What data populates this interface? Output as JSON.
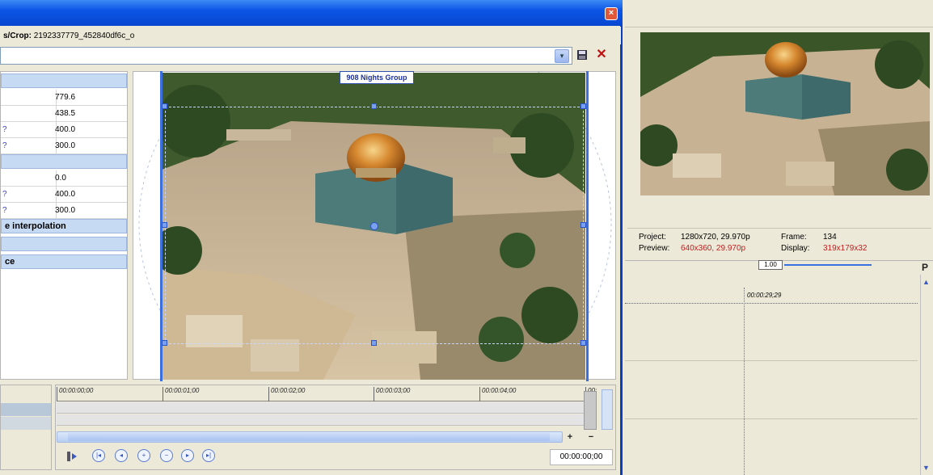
{
  "dialog": {
    "close_glyph": "×",
    "path_prefix": "s/Crop:",
    "path_value": " 2192337779_452840df6c_o"
  },
  "preset": {
    "value": "",
    "dropdown_glyph": "▾",
    "save_glyph": "🖫",
    "delete_glyph": "✕"
  },
  "properties": {
    "rows_a": [
      {
        "label": "",
        "value": "779.6"
      },
      {
        "label": "",
        "value": "438.5"
      },
      {
        "label": "?",
        "value": "400.0"
      },
      {
        "label": "?",
        "value": "300.0"
      }
    ],
    "rows_b": [
      {
        "label": "",
        "value": "0.0"
      },
      {
        "label": "?",
        "value": "400.0"
      },
      {
        "label": "?",
        "value": "300.0"
      }
    ],
    "section_interp": "e interpolation",
    "section_last": "ce"
  },
  "preview": {
    "overlay_label": "908 Nights Group"
  },
  "timeline": {
    "ticks": [
      "00:00:00;00",
      "00:00:01;00",
      "00:00:02;00",
      "00:00:03;00",
      "00:00:04;00",
      "00:"
    ],
    "timecode": "00:00:00;00",
    "zoom_plus": "+",
    "zoom_minus": "−",
    "controls": [
      "first-keyframe",
      "prev-keyframe",
      "add-keyframe",
      "delete-keyframe",
      "next-keyframe",
      "last-keyframe",
      "sync-cursor"
    ]
  },
  "right_pane": {
    "project_label": "Project:",
    "project_value": "1280x720, 29.970p",
    "frame_label": "Frame:",
    "frame_value": "134",
    "preview_label": "Preview:",
    "preview_value": "640x360, 29.970p",
    "display_label": "Display:",
    "display_value": "319x179x32",
    "zoom_box": "1.00",
    "timecode": "00:00:29;29",
    "p_mark": "P"
  },
  "colors": {
    "title_blue": "#0b55e6",
    "section_blue": "#c7daf3",
    "crop_frame": "#3b6fe0",
    "red_text": "#c02020"
  }
}
